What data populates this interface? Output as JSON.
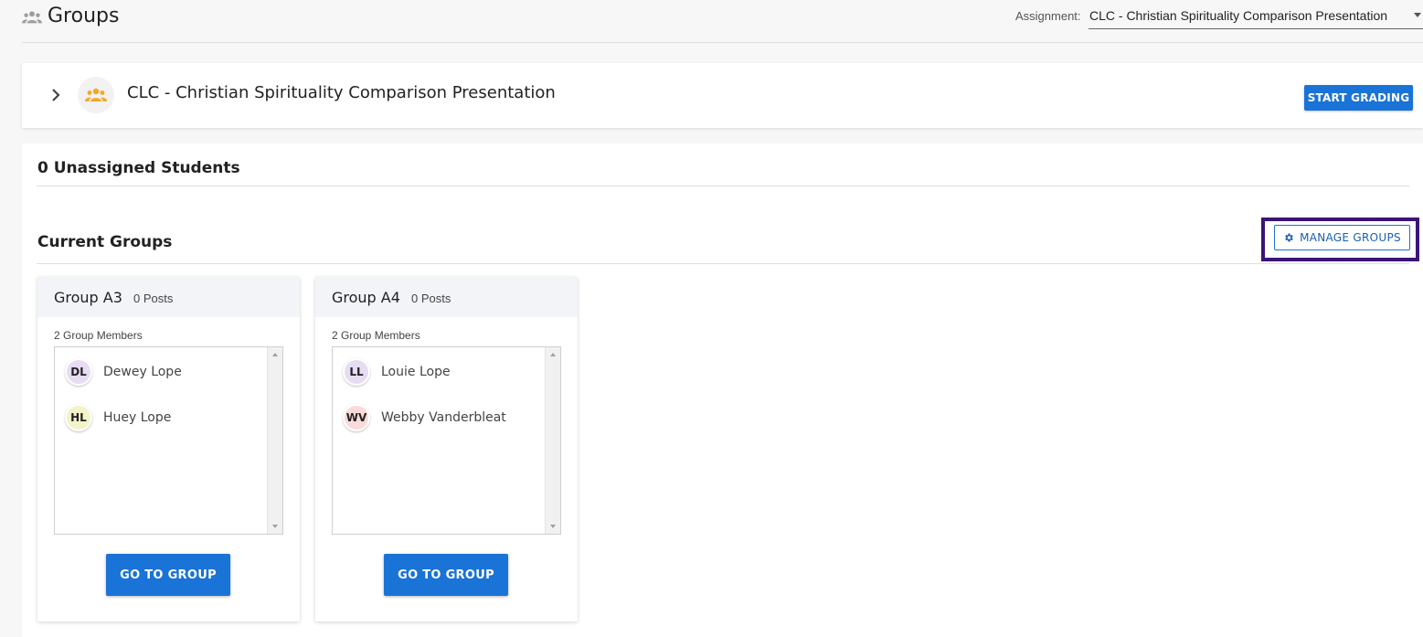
{
  "header": {
    "title": "Groups",
    "assignment_label": "Assignment:",
    "assignment_value": "CLC - Christian Spirituality Comparison Presentation"
  },
  "assignment_card": {
    "name": "CLC - Christian Spirituality Comparison Presentation",
    "start_grading_label": "START GRADING"
  },
  "unassigned": {
    "label": "0 Unassigned Students"
  },
  "current_groups": {
    "label": "Current Groups",
    "manage_label": "MANAGE GROUPS"
  },
  "groups": [
    {
      "name": "Group A3",
      "posts": "0 Posts",
      "members_count": "2 Group Members",
      "members": [
        {
          "initials": "DL",
          "name": "Dewey Lope",
          "color": "#e6ddf2"
        },
        {
          "initials": "HL",
          "name": "Huey Lope",
          "color": "#f3f3c9"
        }
      ],
      "button_label": "GO TO GROUP"
    },
    {
      "name": "Group A4",
      "posts": "0 Posts",
      "members_count": "2 Group Members",
      "members": [
        {
          "initials": "LL",
          "name": "Louie Lope",
          "color": "#e6ddf2"
        },
        {
          "initials": "WV",
          "name": "Webby Vanderbleat",
          "color": "#fadada"
        }
      ],
      "button_label": "GO TO GROUP"
    }
  ],
  "colors": {
    "primary": "#1a73d6",
    "highlight_outline": "#3a1577",
    "group_icon": "#f5a623"
  },
  "icons": [
    "people-icon",
    "chevron-right-icon",
    "group-icon",
    "gear-icon",
    "scroll-up-icon",
    "scroll-down-icon"
  ]
}
